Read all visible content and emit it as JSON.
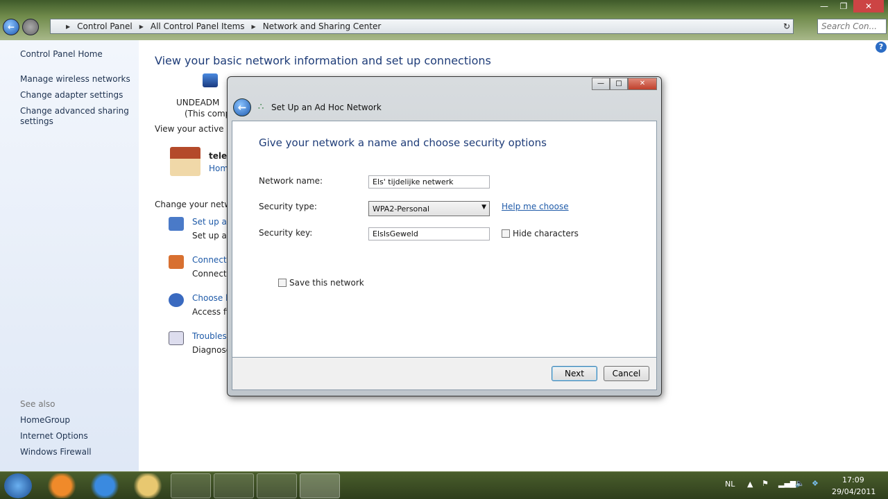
{
  "explorer": {
    "breadcrumb": [
      "Control Panel",
      "All Control Panel Items",
      "Network and Sharing Center"
    ],
    "search_placeholder": "Search Con...",
    "help": "?"
  },
  "sidebar": {
    "home": "Control Panel Home",
    "items": [
      "Manage wireless networks",
      "Change adapter settings",
      "Change advanced sharing settings"
    ],
    "see_also": "See also",
    "see_also_items": [
      "HomeGroup",
      "Internet Options",
      "Windows Firewall"
    ]
  },
  "main": {
    "title": "View your basic network information and set up connections",
    "computer": "UNDEADM",
    "computer_sub": "(This comp",
    "active": "View your active ne",
    "network_name": "tele",
    "network_type": "Hom",
    "change": "Change your netwo",
    "tasks": [
      {
        "link": "Set up a n",
        "desc": "Set up a w"
      },
      {
        "link": "Connect",
        "desc": "Connect"
      },
      {
        "link": "Choose h",
        "desc": "Access fil"
      },
      {
        "link": "Troubles",
        "desc": "Diagnose"
      }
    ]
  },
  "dialog": {
    "title": "Set Up an Ad Hoc Network",
    "heading": "Give your network a name and choose security options",
    "network_name_label": "Network name:",
    "network_name_value": "Els' tijdelijke netwerk",
    "security_type_label": "Security type:",
    "security_type_value": "WPA2-Personal",
    "help_link": "Help me choose",
    "security_key_label": "Security key:",
    "security_key_value": "ElsIsGeweld",
    "hide_chars": "Hide characters",
    "hide_chars_checked": false,
    "save_network": "Save this network",
    "save_network_checked": false,
    "next": "Next",
    "cancel": "Cancel"
  },
  "tray": {
    "lang": "NL",
    "time": "17:09",
    "date": "29/04/2011"
  }
}
